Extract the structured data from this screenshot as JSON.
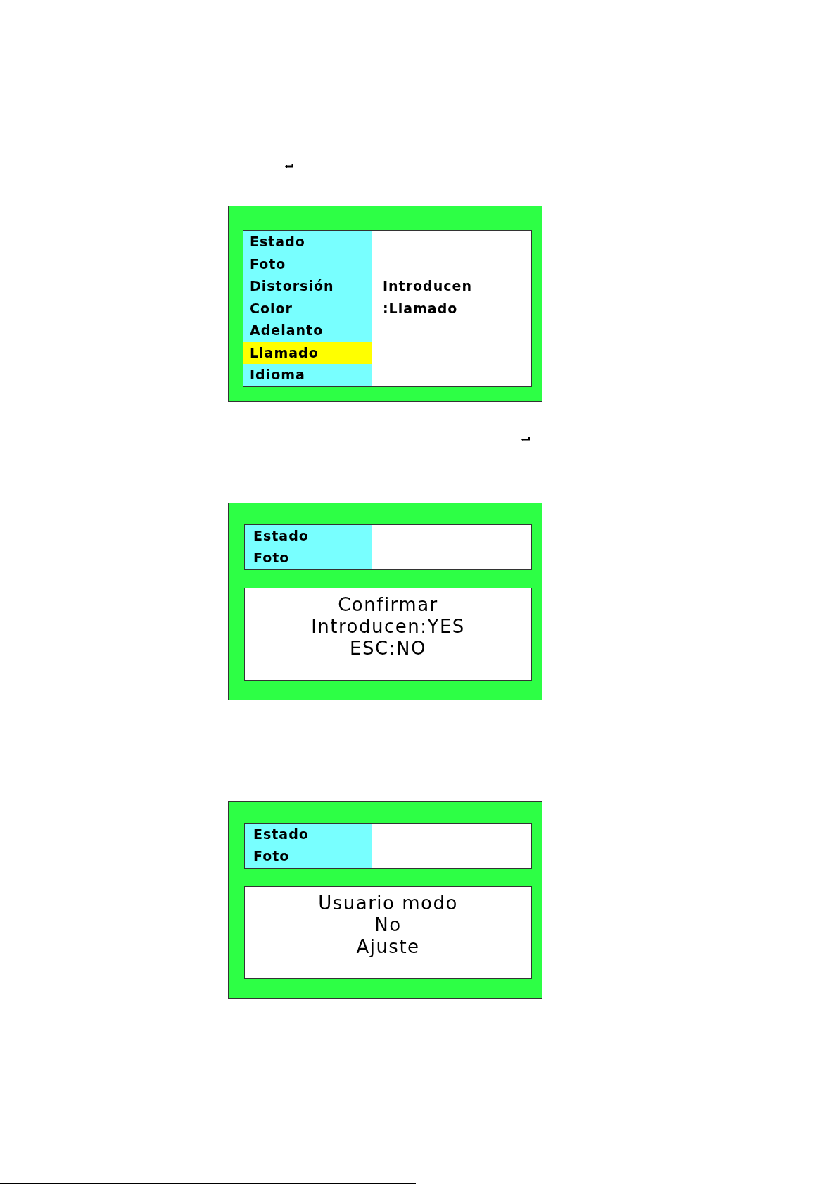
{
  "screens": [
    {
      "kind": "menu",
      "menu_items": [
        {
          "label": "Estado",
          "selected": false
        },
        {
          "label": "Foto",
          "selected": false
        },
        {
          "label": "Distorsión",
          "selected": false
        },
        {
          "label": "Color",
          "selected": false
        },
        {
          "label": "Adelanto",
          "selected": false
        },
        {
          "label": "Llamado",
          "selected": true
        },
        {
          "label": "Idioma",
          "selected": false
        }
      ],
      "detail_lines": [
        "Introducen",
        ":Llamado"
      ]
    },
    {
      "kind": "dialog",
      "menu_items": [
        {
          "label": "Estado",
          "selected": false
        },
        {
          "label": "Foto",
          "selected": false
        }
      ],
      "message_lines": [
        "Confirmar",
        "Introducen:YES",
        "ESC:NO"
      ]
    },
    {
      "kind": "dialog",
      "menu_items": [
        {
          "label": "Estado",
          "selected": false
        },
        {
          "label": "Foto",
          "selected": false
        }
      ],
      "message_lines": [
        "Usuario modo",
        "No",
        "Ajuste"
      ]
    }
  ]
}
